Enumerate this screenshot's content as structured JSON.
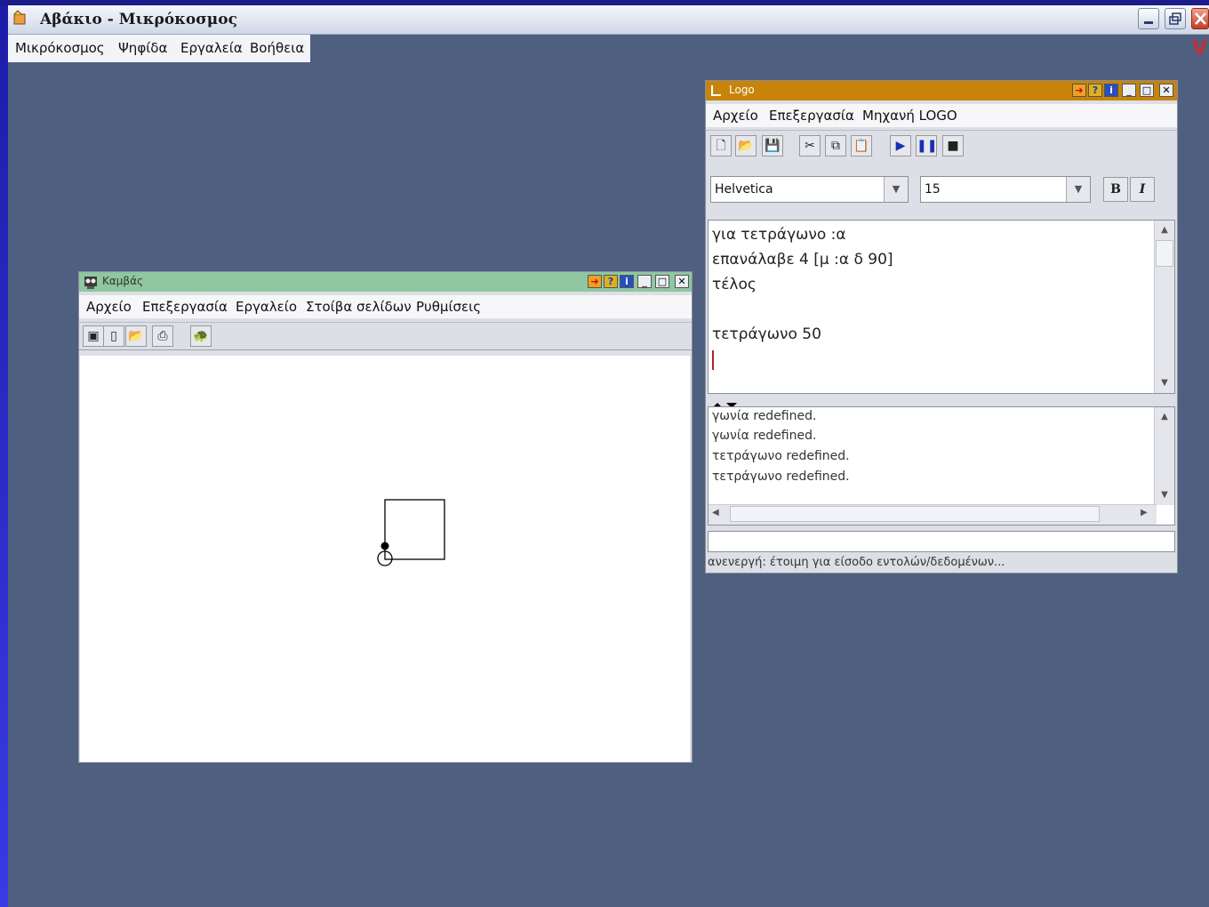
{
  "app": {
    "title": "Αβάκιο - Μικρόκοσμος",
    "menu": [
      "Μικρόκοσμος",
      "Ψηφίδα",
      "Εργαλεία",
      "Βοήθεια"
    ]
  },
  "canvas_window": {
    "title": "Καμβάς",
    "menu": [
      "Αρχείο",
      "Επεξεργασία",
      "Εργαλείο",
      "Στοίβα σελίδων",
      "Ρυθμίσεις"
    ],
    "toolbar_icons": [
      "new-page-icon",
      "page-icon",
      "open-folder-icon",
      "print-icon",
      "turtle-icon"
    ]
  },
  "logo_window": {
    "title": "Logo",
    "menu": [
      "Αρχείο",
      "Επεξεργασία",
      "Μηχανή LOGO"
    ],
    "font_family": "Helvetica",
    "font_size": "15",
    "bold_label": "B",
    "italic_label": "I",
    "editor_lines": [
      "για τετράγωνο :α",
      "επανάλαβε 4 [μ :α δ 90]",
      "τέλος",
      "",
      "τετράγωνο 50"
    ],
    "output_lines": [
      "γωνία redefined.",
      "γωνία redefined.",
      "τετράγωνο redefined.",
      "τετράγωνο redefined."
    ],
    "command_input": "",
    "status": "ανενεργή: έτοιμη για είσοδο εντολών/δεδομένων..."
  },
  "colors": {
    "desktop": "#4f5f80",
    "canvas_titlebar": "#8ec7a0",
    "logo_titlebar": "#c8840a"
  }
}
